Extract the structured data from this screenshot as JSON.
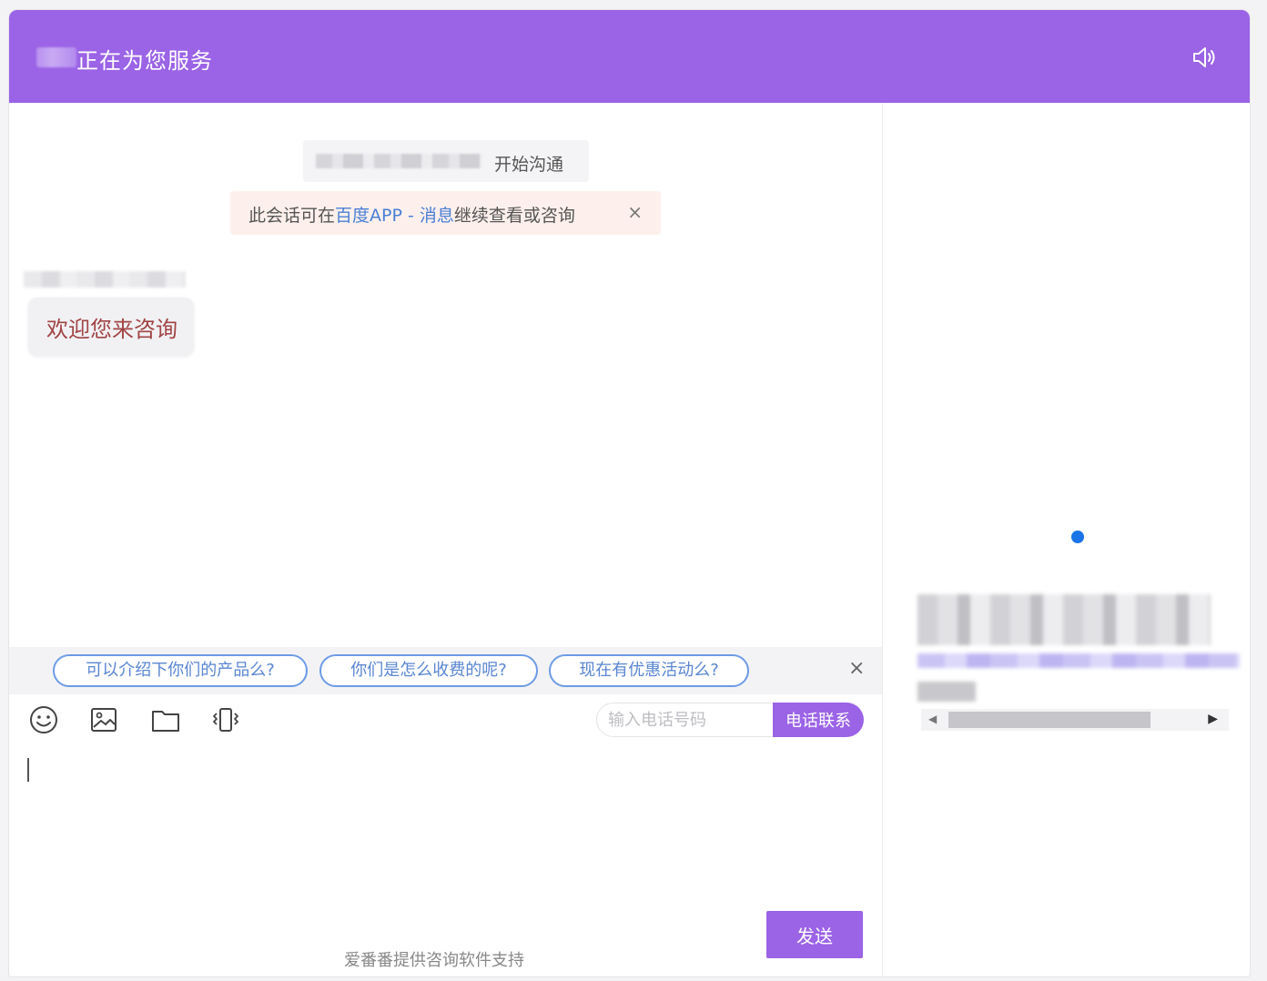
{
  "header": {
    "title": "正在为您服务"
  },
  "chat": {
    "start_notice": "开始沟通",
    "app_notice": {
      "prefix": "此会话可在",
      "link": "百度APP - 消息",
      "suffix": "继续查看或咨询",
      "close": "×"
    },
    "welcome_message": "欢迎您来咨询"
  },
  "quick_questions": [
    "可以介绍下你们的产品么?",
    "你们是怎么收费的呢?",
    "现在有优惠活动么?"
  ],
  "quick_close": "×",
  "phone": {
    "placeholder": "输入电话号码",
    "button": "电话联系"
  },
  "send_button": "发送",
  "footer": "爱番番提供咨询软件支持",
  "colors": {
    "brand": "#9b63e6",
    "link": "#4a7fd6",
    "welcome_text": "#a14444",
    "dot": "#1a73e8"
  },
  "icons": {
    "header": "speaker-icon",
    "tools": [
      "emoji-icon",
      "image-icon",
      "folder-icon",
      "vibrate-icon"
    ]
  }
}
